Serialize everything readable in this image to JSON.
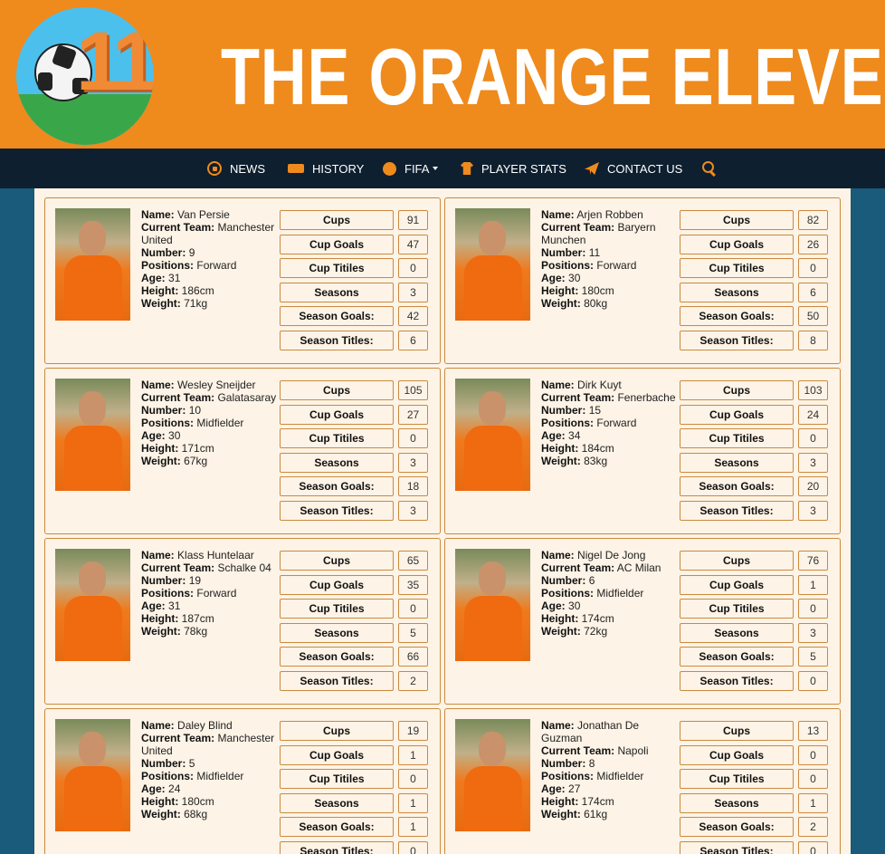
{
  "site": {
    "title": "THE ORANGE ELEVEN",
    "logo_number": "11"
  },
  "nav": [
    {
      "label": "NEWS",
      "icon": "soccer-ball-icon"
    },
    {
      "label": "HISTORY",
      "icon": "stadium-icon"
    },
    {
      "label": "FIFA",
      "icon": "fifa-icon",
      "dropdown": true
    },
    {
      "label": "PLAYER STATS",
      "icon": "jersey-icon"
    },
    {
      "label": "CONTACT US",
      "icon": "paper-plane-icon"
    }
  ],
  "labels": {
    "name": "Name:",
    "team": "Current Team:",
    "number": "Number:",
    "positions": "Positions:",
    "age": "Age:",
    "height": "Height:",
    "weight": "Weight:",
    "cups": "Cups",
    "cup_goals": "Cup Goals",
    "cup_titles": "Cup Titiles",
    "seasons": "Seasons",
    "season_goals": "Season Goals:",
    "season_titles": "Season Titles:"
  },
  "colors": {
    "orange": "#ef8a1d",
    "navy": "#0e1f2f",
    "cream": "#fdf3e6",
    "border": "#c98a3f",
    "page_bg": "#1a5a7a"
  },
  "players": [
    {
      "name": "Van Persie",
      "team": "Manchester United",
      "number": "9",
      "positions": "Forward",
      "age": "31",
      "height": "186cm",
      "weight": "71kg",
      "cups": "91",
      "cup_goals": "47",
      "cup_titles": "0",
      "seasons": "3",
      "season_goals": "42",
      "season_titles": "6"
    },
    {
      "name": "Arjen Robben",
      "team": "Baryern Munchen",
      "number": "11",
      "positions": "Forward",
      "age": "30",
      "height": "180cm",
      "weight": "80kg",
      "cups": "82",
      "cup_goals": "26",
      "cup_titles": "0",
      "seasons": "6",
      "season_goals": "50",
      "season_titles": "8"
    },
    {
      "name": "Wesley Sneijder",
      "team": "Galatasaray",
      "number": "10",
      "positions": "Midfielder",
      "age": "30",
      "height": "171cm",
      "weight": "67kg",
      "cups": "105",
      "cup_goals": "27",
      "cup_titles": "0",
      "seasons": "3",
      "season_goals": "18",
      "season_titles": "3"
    },
    {
      "name": "Dirk Kuyt",
      "team": "Fenerbache",
      "number": "15",
      "positions": "Forward",
      "age": "34",
      "height": "184cm",
      "weight": "83kg",
      "cups": "103",
      "cup_goals": "24",
      "cup_titles": "0",
      "seasons": "3",
      "season_goals": "20",
      "season_titles": "3"
    },
    {
      "name": "Klass Huntelaar",
      "team": "Schalke 04",
      "number": "19",
      "positions": "Forward",
      "age": "31",
      "height": "187cm",
      "weight": "78kg",
      "cups": "65",
      "cup_goals": "35",
      "cup_titles": "0",
      "seasons": "5",
      "season_goals": "66",
      "season_titles": "2"
    },
    {
      "name": "Nigel De Jong",
      "team": "AC Milan",
      "number": "6",
      "positions": "Midfielder",
      "age": "30",
      "height": "174cm",
      "weight": "72kg",
      "cups": "76",
      "cup_goals": "1",
      "cup_titles": "0",
      "seasons": "3",
      "season_goals": "5",
      "season_titles": "0"
    },
    {
      "name": "Daley Blind",
      "team": "Manchester United",
      "number": "5",
      "positions": "Midfielder",
      "age": "24",
      "height": "180cm",
      "weight": "68kg",
      "cups": "19",
      "cup_goals": "1",
      "cup_titles": "0",
      "seasons": "1",
      "season_goals": "1",
      "season_titles": "0"
    },
    {
      "name": "Jonathan De Guzman",
      "team": "Napoli",
      "number": "8",
      "positions": "Midfielder",
      "age": "27",
      "height": "174cm",
      "weight": "61kg",
      "cups": "13",
      "cup_goals": "0",
      "cup_titles": "0",
      "seasons": "1",
      "season_goals": "2",
      "season_titles": "0"
    }
  ]
}
